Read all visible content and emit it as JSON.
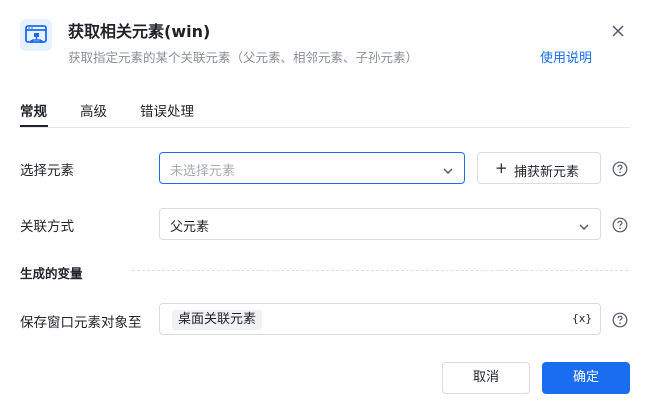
{
  "dialog": {
    "title": "获取相关元素(win)",
    "subtitle": "获取指定元素的某个关联元素（父元素、相邻元素、子孙元素）",
    "help_link": "使用说明",
    "accent": "#1a6cf0"
  },
  "tabs": [
    {
      "label": "常规",
      "active": true
    },
    {
      "label": "高级",
      "active": false
    },
    {
      "label": "错误处理",
      "active": false
    }
  ],
  "form": {
    "select_element": {
      "label": "选择元素",
      "placeholder": "未选择元素",
      "capture_button": "捕获新元素"
    },
    "relation": {
      "label": "关联方式",
      "value": "父元素"
    },
    "section_title": "生成的变量",
    "output": {
      "label": "保存窗口元素对象至",
      "value": "桌面关联元素",
      "var_icon_text": "{x}"
    }
  },
  "footer": {
    "cancel": "取消",
    "confirm": "确定"
  }
}
